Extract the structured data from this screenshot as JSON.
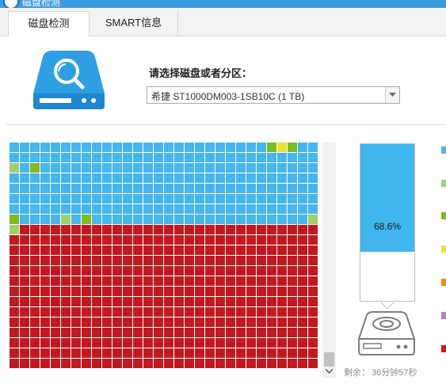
{
  "window": {
    "title": "磁盘检测"
  },
  "tabs": [
    {
      "label": "磁盘检测",
      "active": true
    },
    {
      "label": "SMART信息",
      "active": false
    }
  ],
  "disk_select": {
    "label": "请选择磁盘或者分区：",
    "selected": "希捷 ST1000DM003-1SB10C  (1 TB)"
  },
  "scan_grid": {
    "columns": 30,
    "rows": 22,
    "blue_rows": 8,
    "colors": {
      "blue": "#45b7ee",
      "red": "#c0191f",
      "light_green": "#9fd16a",
      "green": "#7cbc1c",
      "yellow": "#e6e52e"
    },
    "special_cells": [
      {
        "row": 0,
        "col": 25,
        "state": "green"
      },
      {
        "row": 0,
        "col": 26,
        "state": "yellow"
      },
      {
        "row": 0,
        "col": 27,
        "state": "green"
      },
      {
        "row": 2,
        "col": 0,
        "state": "light_green"
      },
      {
        "row": 2,
        "col": 2,
        "state": "green"
      },
      {
        "row": 7,
        "col": 0,
        "state": "green"
      },
      {
        "row": 7,
        "col": 5,
        "state": "light_green"
      },
      {
        "row": 7,
        "col": 7,
        "state": "green"
      },
      {
        "row": 7,
        "col": 29,
        "state": "light_green"
      },
      {
        "row": 8,
        "col": 0,
        "state": "light_green"
      }
    ]
  },
  "usage": {
    "percent_text": "68.6%",
    "fraction": 0.686
  },
  "remaining": {
    "label": "剩余：",
    "value": "36分钟57秒"
  },
  "legend_colors": [
    "#45b7ee",
    "#9fd16a",
    "#7cbc1c",
    "#e6e52e",
    "#f08a1c",
    "#c77bcf",
    "#d4141c"
  ],
  "icons": [
    "disk-search-icon",
    "hdd-icon",
    "dropdown-arrow-icon",
    "scroll-down-arrow-icon"
  ]
}
